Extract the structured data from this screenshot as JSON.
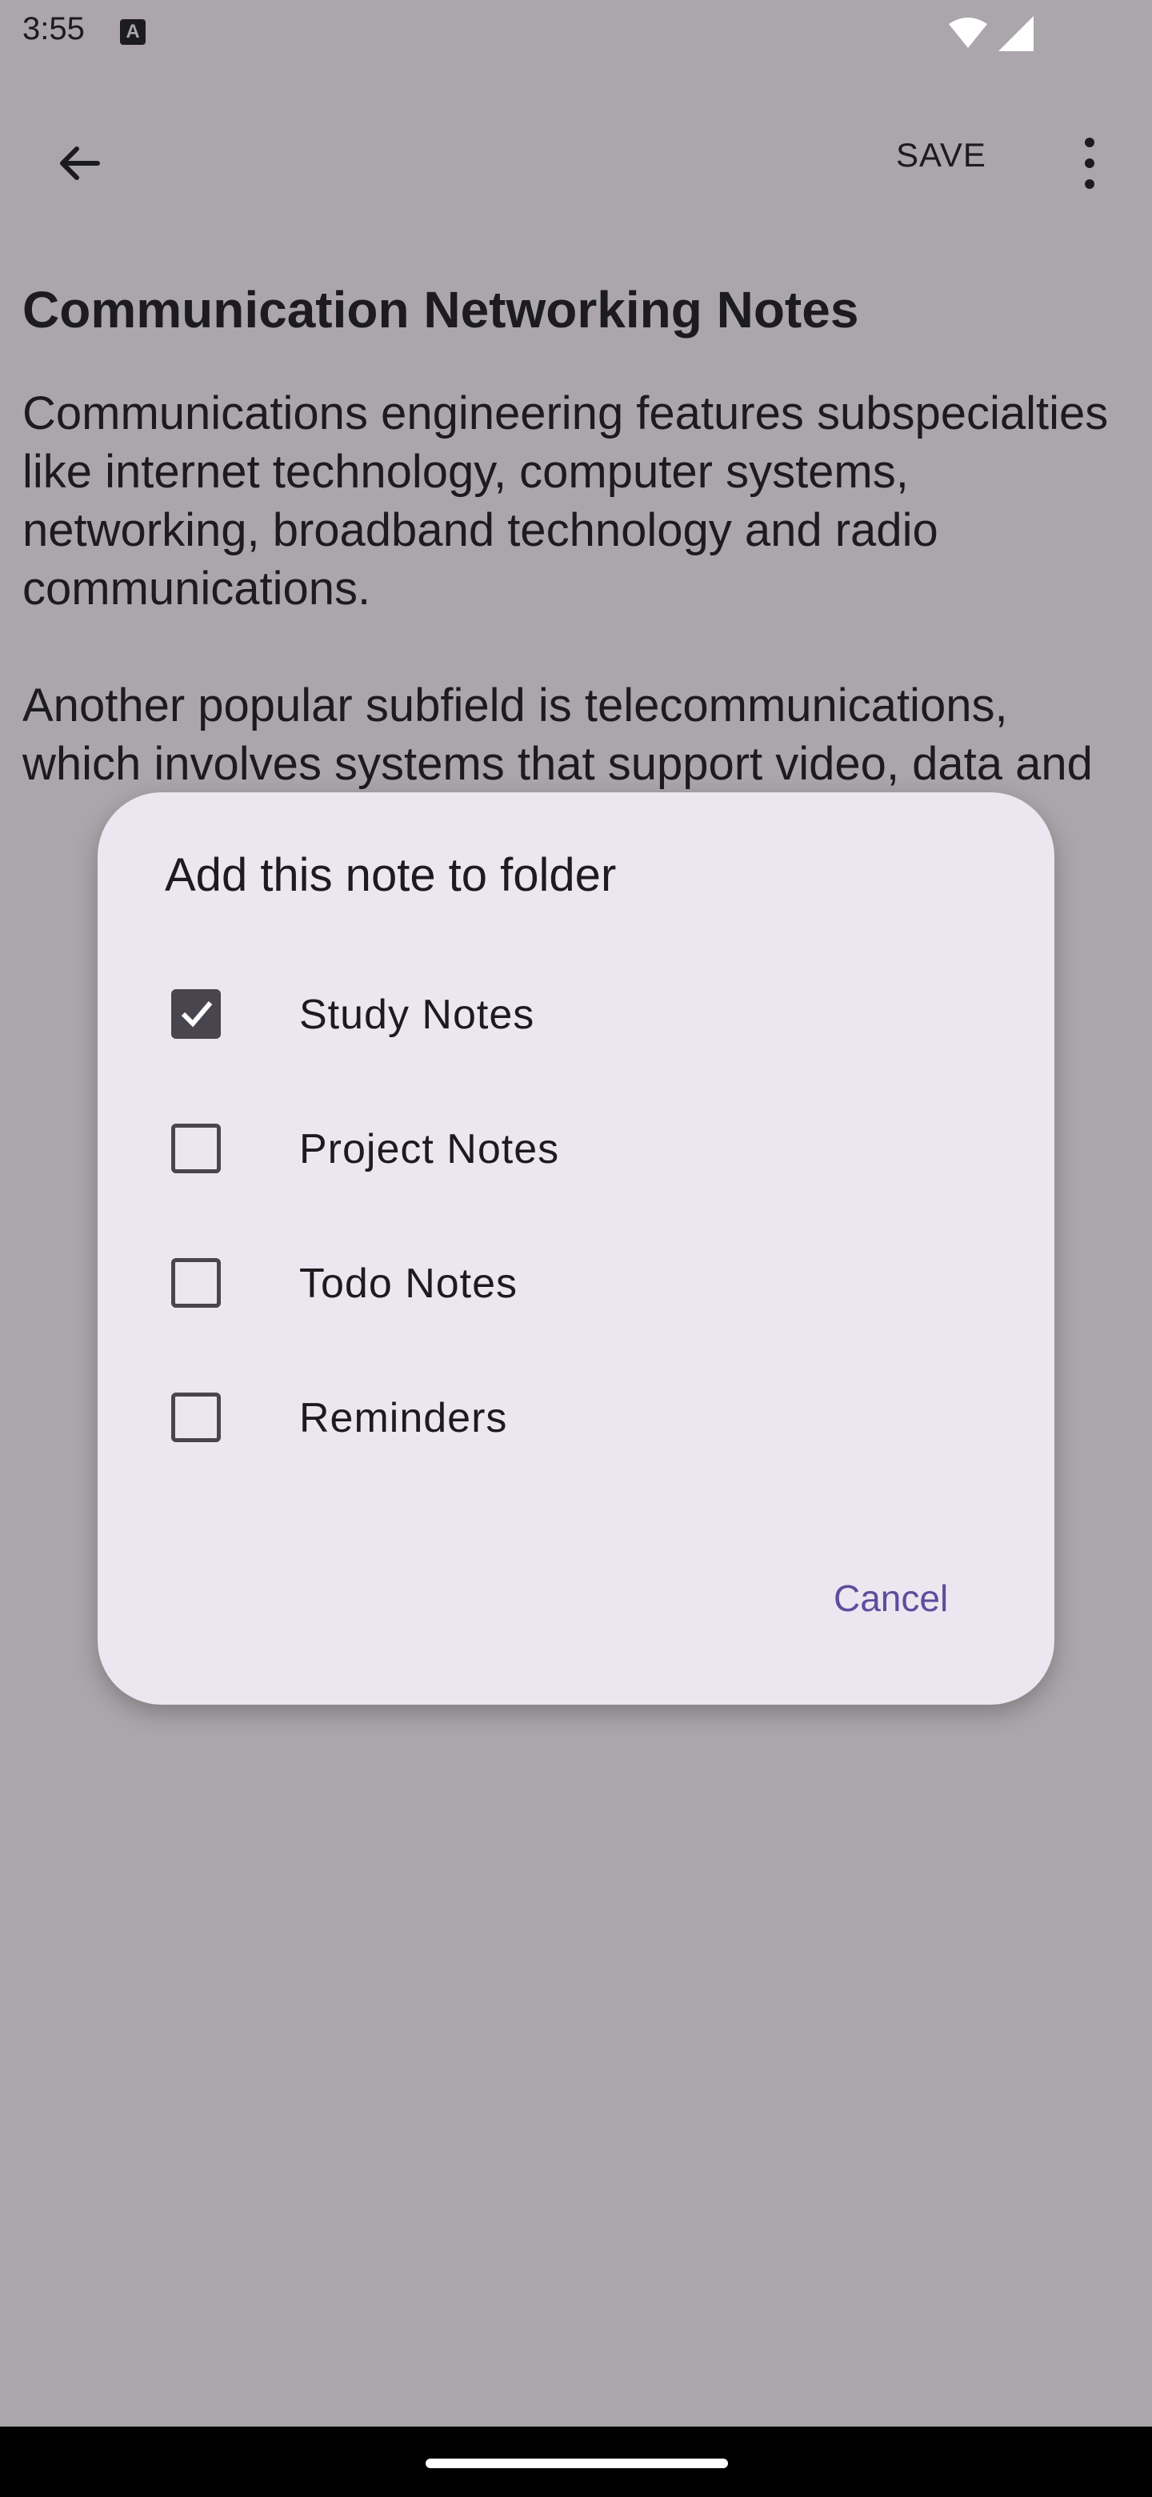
{
  "status_bar": {
    "time": "3:55",
    "notification_icon": "A"
  },
  "app_bar": {
    "back_icon": "arrow-left-icon",
    "save_label": "SAVE",
    "more_icon": "more-vert-icon"
  },
  "note": {
    "title": "Communication Networking Notes",
    "body": "Communications engineering features subspecialties like internet technology, computer systems, networking, broadband technology and radio communications.\n\nAnother popular subfield is telecommunications, which involves systems that support video, data and"
  },
  "dialog": {
    "title": "Add this note to folder",
    "options": [
      {
        "label": "Study Notes",
        "checked": true
      },
      {
        "label": "Project Notes",
        "checked": false
      },
      {
        "label": "Todo Notes",
        "checked": false
      },
      {
        "label": "Reminders",
        "checked": false
      }
    ],
    "cancel_label": "Cancel"
  },
  "colors": {
    "scrim_background": "#aaa6ab",
    "dialog_surface": "#ece6f0",
    "accent": "#5e4d9c"
  }
}
